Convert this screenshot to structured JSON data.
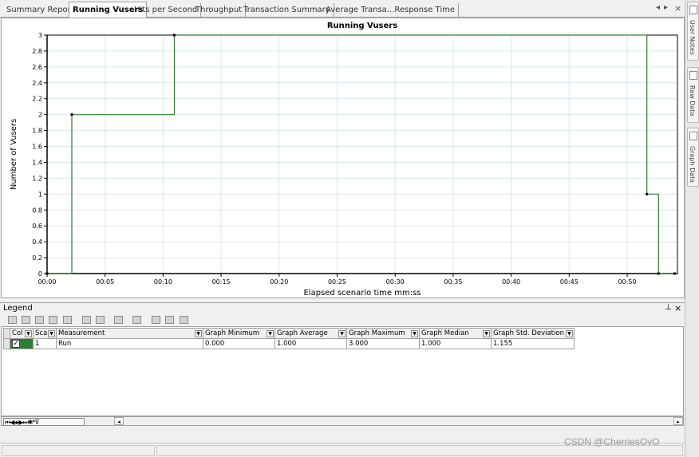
{
  "tabs": [
    {
      "label": "Summary Report"
    },
    {
      "label": "Running Vusers"
    },
    {
      "label": "Hits per Second"
    },
    {
      "label": "Throughput"
    },
    {
      "label": "Transaction Summary"
    },
    {
      "label": "Average Transa...Response Time"
    }
  ],
  "side_panel": {
    "user_notes": "User Notes",
    "raw_data": "Raw Data",
    "graph_data": "Graph Data"
  },
  "chart_data": {
    "type": "line",
    "title": "Running Vusers",
    "xlabel": "Elapsed scenario time mm:ss",
    "ylabel": "Number of Vusers",
    "xlim": [
      0,
      3260
    ],
    "ylim": [
      0,
      3
    ],
    "xticks": [
      "00:00",
      "00:05",
      "00:10",
      "00:15",
      "00:20",
      "00:25",
      "00:30",
      "00:35",
      "00:40",
      "00:45",
      "00:50"
    ],
    "yticks": [
      "0",
      "0.2",
      "0.4",
      "0.6",
      "0.8",
      "1",
      "1.2",
      "1.4",
      "1.6",
      "1.8",
      "2",
      "2.2",
      "2.4",
      "2.6",
      "2.8",
      "3"
    ],
    "grid": true,
    "series": [
      {
        "name": "Run",
        "color": "#2e7d32",
        "step": true,
        "points": [
          {
            "x": 0,
            "y": 0
          },
          {
            "x": 128,
            "y": 0
          },
          {
            "x": 128,
            "y": 2
          },
          {
            "x": 658,
            "y": 2
          },
          {
            "x": 658,
            "y": 3
          },
          {
            "x": 3102,
            "y": 3
          },
          {
            "x": 3102,
            "y": 1
          },
          {
            "x": 3162,
            "y": 1
          },
          {
            "x": 3162,
            "y": 0
          },
          {
            "x": 3245,
            "y": 0
          }
        ]
      }
    ]
  },
  "legend": {
    "title": "Legend",
    "pin_icon": "pin-icon",
    "close_label": "×",
    "columns": [
      "Col",
      "Sca",
      "Measurement",
      "Graph Minimum",
      "Graph Average",
      "Graph Maximum",
      "Graph Median",
      "Graph Std. Deviation"
    ],
    "rows": [
      {
        "color": "#2e7d32",
        "checked": true,
        "scale": "1",
        "measurement": "Run",
        "min": "0.000",
        "avg": "1.000",
        "max": "3.000",
        "median": "1.000",
        "stddev": "1.155"
      }
    ]
  },
  "watermark": "CSDN @CherriesOvO"
}
